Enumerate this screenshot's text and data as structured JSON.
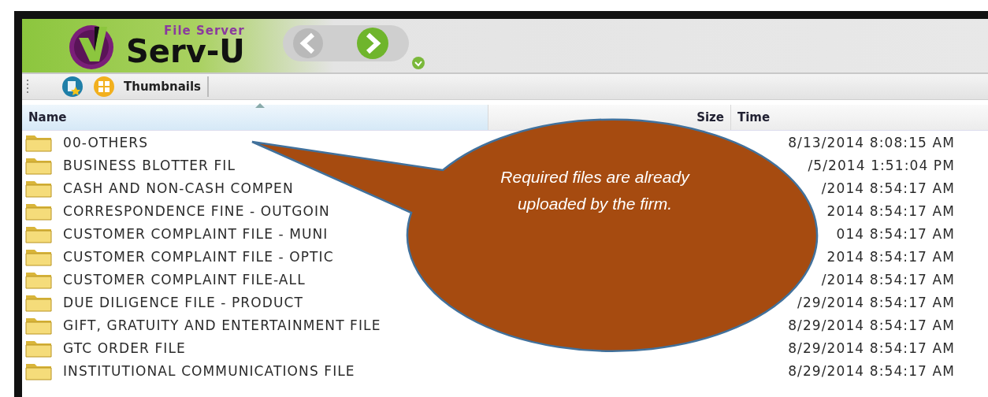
{
  "logo": {
    "subtitle": "File Server",
    "title": "Serv-U"
  },
  "toolbar": {
    "view_label": "Thumbnails"
  },
  "table": {
    "columns": [
      {
        "label": "Name",
        "sorted": true
      },
      {
        "label": "Size",
        "sorted": false
      },
      {
        "label": "Time",
        "sorted": false
      }
    ],
    "rows": [
      {
        "name": "00-OTHERS",
        "time": "8/13/2014 8:08:15 AM"
      },
      {
        "name": "BUSINESS BLOTTER FIL",
        "time": "/5/2014 1:51:04 PM"
      },
      {
        "name": "CASH AND NON-CASH COMPEN",
        "time": "/2014 8:54:17 AM"
      },
      {
        "name": "CORRESPONDENCE FINE - OUTGOIN",
        "time": "2014 8:54:17 AM"
      },
      {
        "name": "CUSTOMER COMPLAINT FILE - MUNI",
        "time": "014 8:54:17 AM"
      },
      {
        "name": "CUSTOMER COMPLAINT FILE - OPTIC",
        "time": "2014 8:54:17 AM"
      },
      {
        "name": "CUSTOMER COMPLAINT FILE-ALL",
        "time": "/2014 8:54:17 AM"
      },
      {
        "name": "DUE DILIGENCE FILE - PRODUCT",
        "time": "/29/2014 8:54:17 AM"
      },
      {
        "name": "GIFT, GRATUITY AND ENTERTAINMENT FILE",
        "time": "8/29/2014 8:54:17 AM"
      },
      {
        "name": "GTC ORDER FILE",
        "time": "8/29/2014 8:54:17 AM"
      },
      {
        "name": "INSTITUTIONAL COMMUNICATIONS FILE",
        "time": "8/29/2014 8:54:17 AM"
      }
    ]
  },
  "callout": {
    "text": "Required files are already uploaded by the firm."
  }
}
